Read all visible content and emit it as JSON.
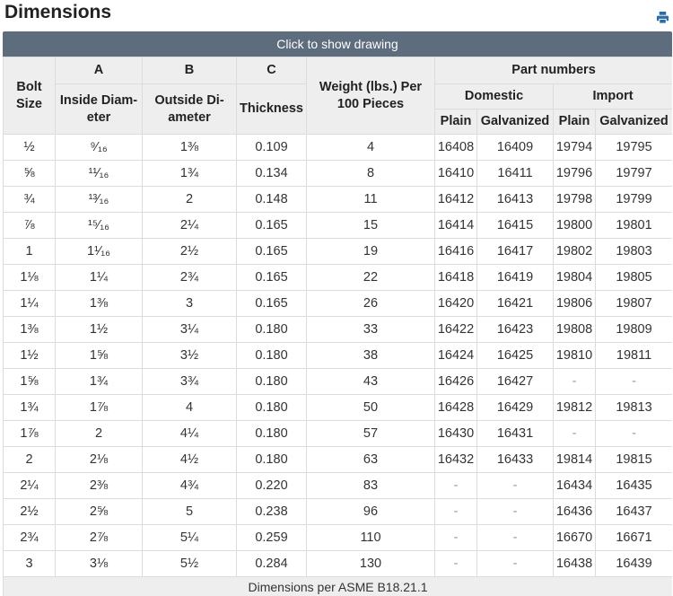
{
  "title": "Dimensions",
  "print_icon": "printer-icon",
  "show_drawing": "Click to show drawing",
  "headers": {
    "bolt_size": "Bolt Size",
    "a": "A",
    "b": "B",
    "c": "C",
    "inside_diameter": "Inside Diam-eter",
    "outside_diameter": "Outside Di-ameter",
    "thickness": "Thickness",
    "weight": "Weight (lbs.) Per 100 Pieces",
    "part_numbers": "Part numbers",
    "domestic": "Domestic",
    "import": "Import",
    "plain_1": "Plain",
    "galvanized_1": "Galvanized",
    "plain_2": "Plain",
    "galvanized_2": "Galvanized"
  },
  "rows": [
    [
      "½",
      "⁹⁄₁₆",
      "1⅜",
      "0.109",
      "4",
      "16408",
      "16409",
      "19794",
      "19795"
    ],
    [
      "⅝",
      "¹¹⁄₁₆",
      "1¾",
      "0.134",
      "8",
      "16410",
      "16411",
      "19796",
      "19797"
    ],
    [
      "¾",
      "¹³⁄₁₆",
      "2",
      "0.148",
      "11",
      "16412",
      "16413",
      "19798",
      "19799"
    ],
    [
      "⅞",
      "¹⁵⁄₁₆",
      "2¼",
      "0.165",
      "15",
      "16414",
      "16415",
      "19800",
      "19801"
    ],
    [
      "1",
      "1¹⁄₁₆",
      "2½",
      "0.165",
      "19",
      "16416",
      "16417",
      "19802",
      "19803"
    ],
    [
      "1⅛",
      "1¼",
      "2¾",
      "0.165",
      "22",
      "16418",
      "16419",
      "19804",
      "19805"
    ],
    [
      "1¼",
      "1⅜",
      "3",
      "0.165",
      "26",
      "16420",
      "16421",
      "19806",
      "19807"
    ],
    [
      "1⅜",
      "1½",
      "3¼",
      "0.180",
      "33",
      "16422",
      "16423",
      "19808",
      "19809"
    ],
    [
      "1½",
      "1⅝",
      "3½",
      "0.180",
      "38",
      "16424",
      "16425",
      "19810",
      "19811"
    ],
    [
      "1⅝",
      "1¾",
      "3¾",
      "0.180",
      "43",
      "16426",
      "16427",
      "-",
      "-"
    ],
    [
      "1¾",
      "1⅞",
      "4",
      "0.180",
      "50",
      "16428",
      "16429",
      "19812",
      "19813"
    ],
    [
      "1⅞",
      "2",
      "4¼",
      "0.180",
      "57",
      "16430",
      "16431",
      "-",
      "-"
    ],
    [
      "2",
      "2⅛",
      "4½",
      "0.180",
      "63",
      "16432",
      "16433",
      "19814",
      "19815"
    ],
    [
      "2¼",
      "2⅜",
      "4¾",
      "0.220",
      "83",
      "-",
      "-",
      "16434",
      "16435"
    ],
    [
      "2½",
      "2⅝",
      "5",
      "0.238",
      "96",
      "-",
      "-",
      "16436",
      "16437"
    ],
    [
      "2¾",
      "2⅞",
      "5¼",
      "0.259",
      "110",
      "-",
      "-",
      "16670",
      "16671"
    ],
    [
      "3",
      "3⅛",
      "5½",
      "0.284",
      "130",
      "-",
      "-",
      "16438",
      "16439"
    ]
  ],
  "footer": "Dimensions per ASME B18.21.1"
}
